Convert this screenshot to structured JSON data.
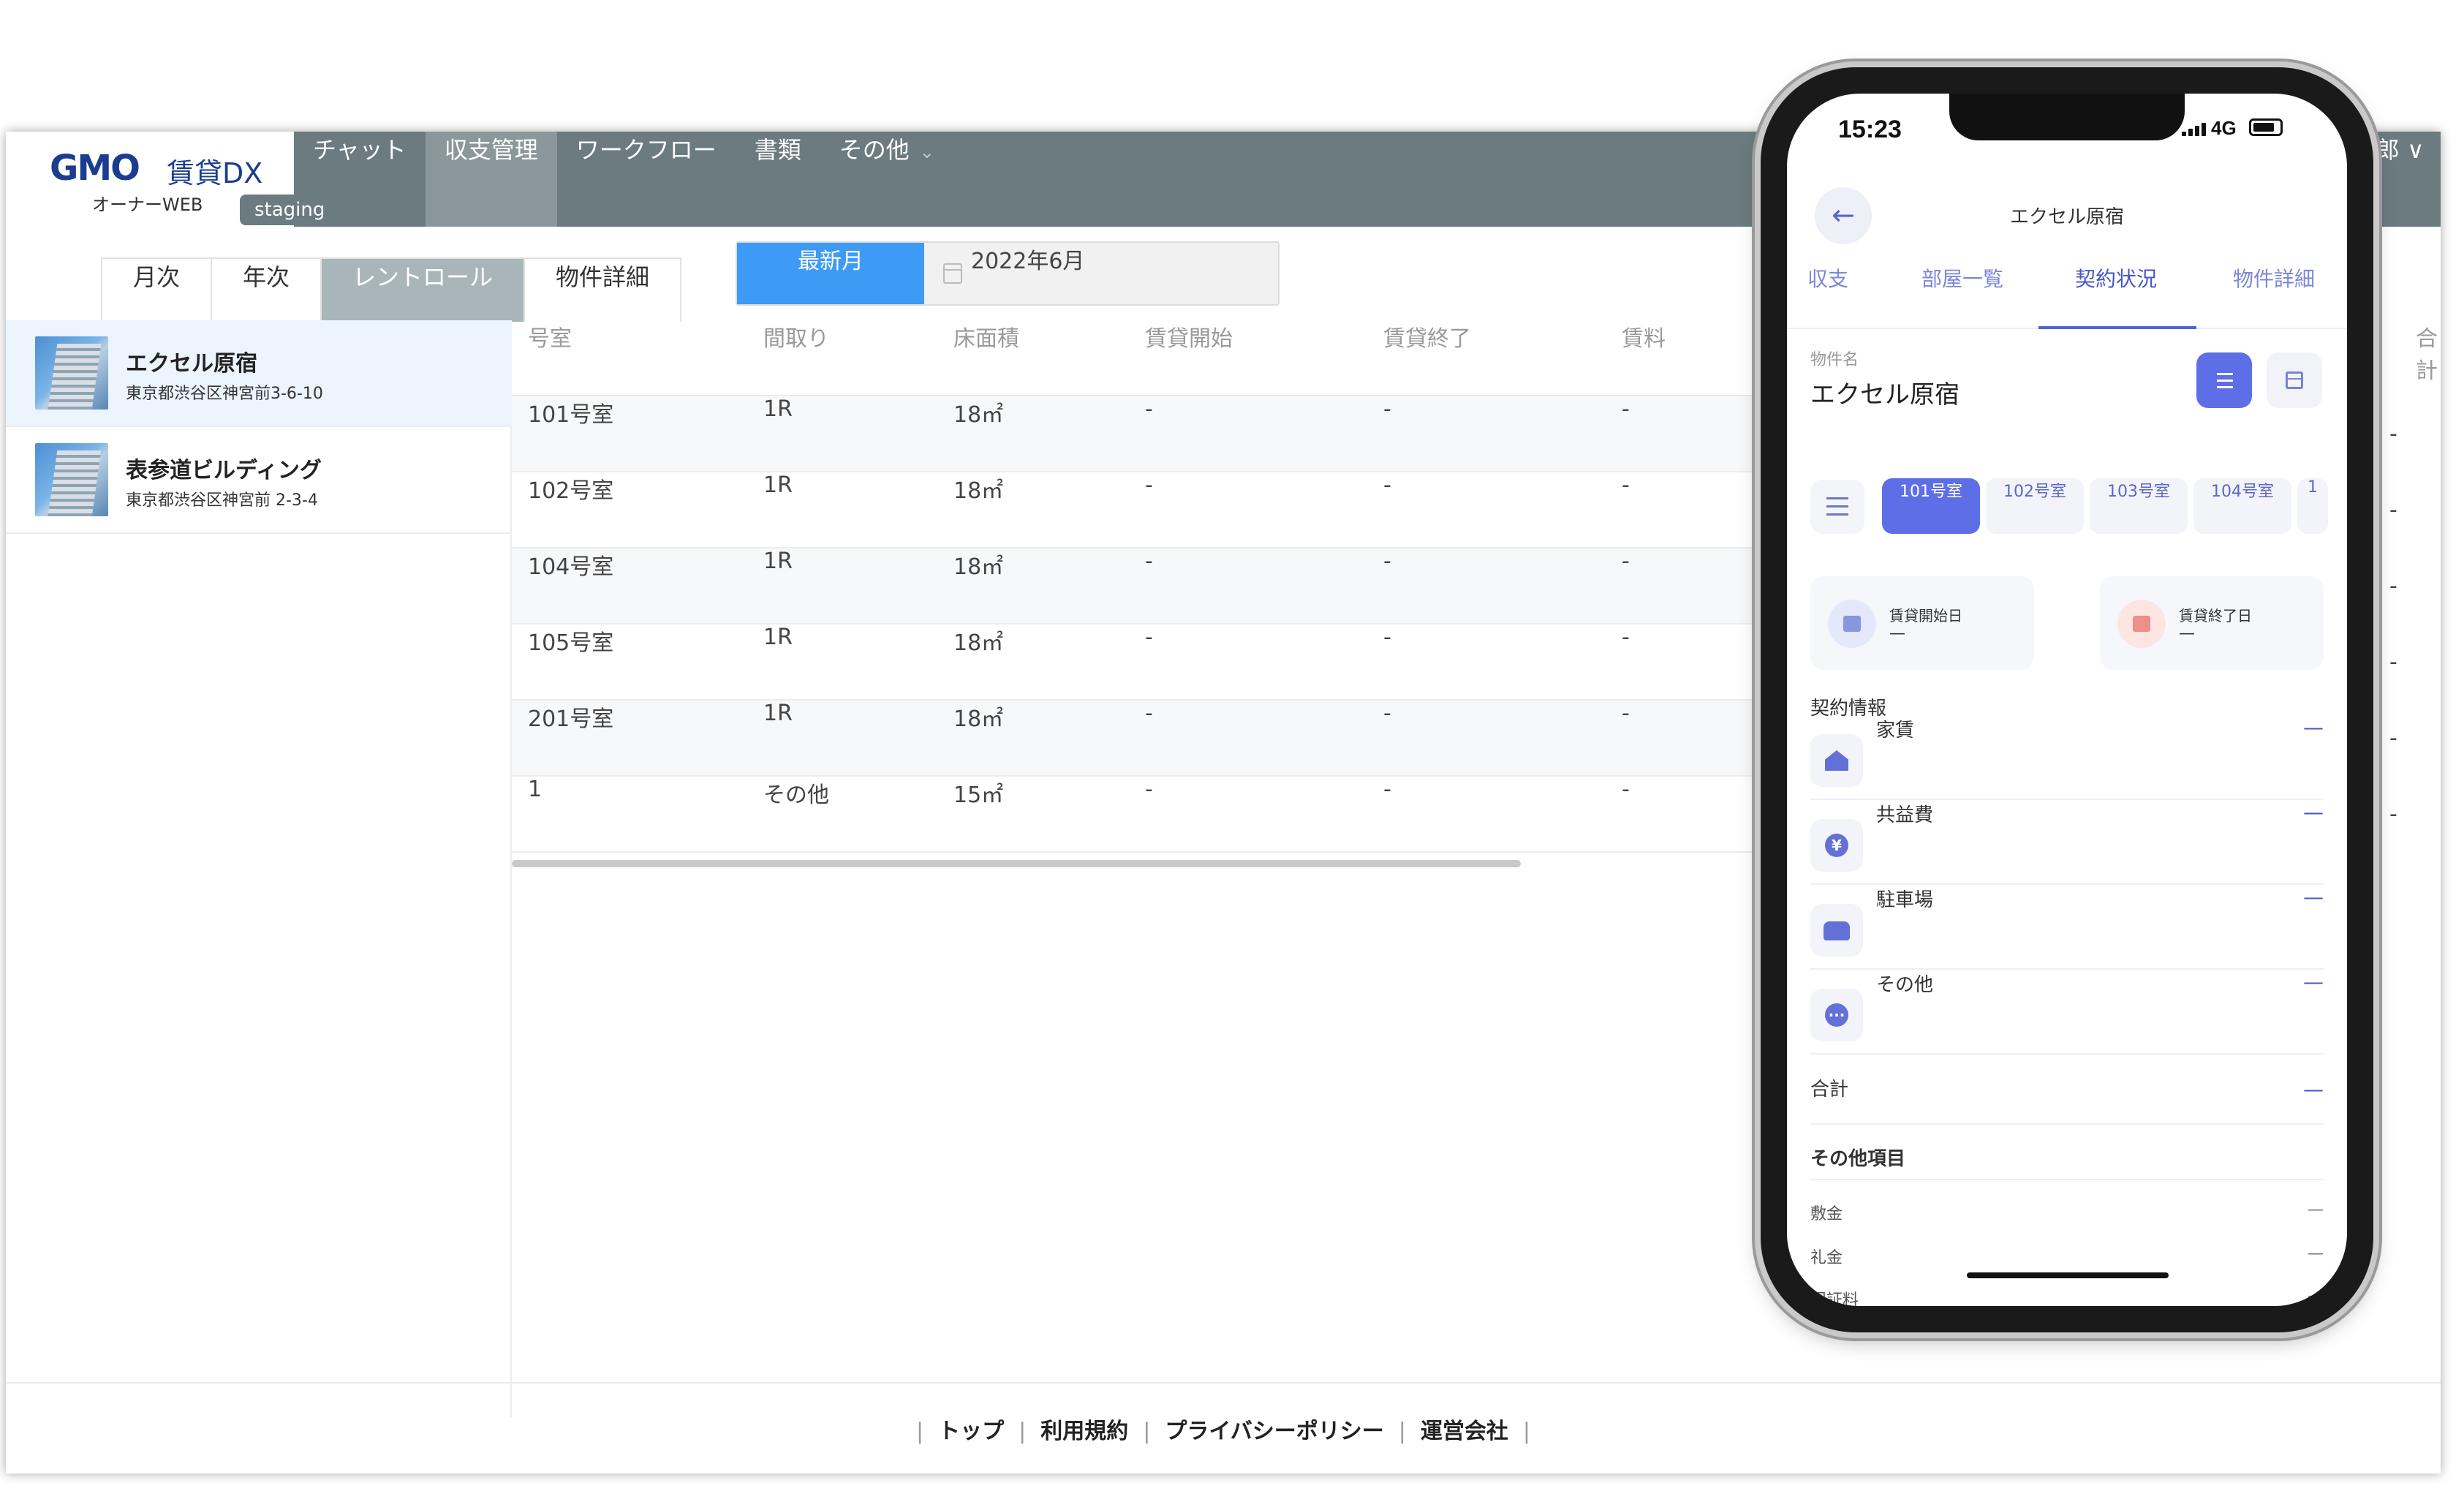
{
  "web": {
    "logo": {
      "brand": "GMO",
      "product": "賃貸DX",
      "sub": "オーナーWEB",
      "env_badge": "staging"
    },
    "nav": [
      {
        "label": "チャット"
      },
      {
        "label": "収支管理"
      },
      {
        "label": "ワークフロー"
      },
      {
        "label": "書類"
      },
      {
        "label": "その他"
      }
    ],
    "user_name_partial": "郎 ∨",
    "tabs": [
      {
        "label": "月次"
      },
      {
        "label": "年次"
      },
      {
        "label": "レントロール"
      },
      {
        "label": "物件詳細"
      }
    ],
    "month_selector": {
      "latest_label": "最新月",
      "value": "2022年6月"
    },
    "properties": [
      {
        "name": "エクセル原宿",
        "address": "東京都渋谷区神宮前3-6-10"
      },
      {
        "name": "表参道ビルディング",
        "address": "東京都渋谷区神宮前 2-3-4"
      }
    ],
    "table": {
      "headers": [
        "号室",
        "間取り",
        "床面積",
        "賃貸開始",
        "賃貸終了",
        "賃料"
      ],
      "total_header": "合計",
      "rows": [
        [
          "101号室",
          "1R",
          "18㎡",
          "-",
          "-",
          "-"
        ],
        [
          "102号室",
          "1R",
          "18㎡",
          "-",
          "-",
          "-"
        ],
        [
          "104号室",
          "1R",
          "18㎡",
          "-",
          "-",
          "-"
        ],
        [
          "105号室",
          "1R",
          "18㎡",
          "-",
          "-",
          "-"
        ],
        [
          "201号室",
          "1R",
          "18㎡",
          "-",
          "-",
          "-"
        ],
        [
          "1",
          "その他",
          "15㎡",
          "-",
          "-",
          "-"
        ]
      ],
      "edge_values": [
        "-",
        "-",
        "-",
        "-",
        "-",
        "-"
      ]
    },
    "footer": {
      "links": [
        "トップ",
        "利用規約",
        "プライバシーポリシー",
        "運営会社"
      ],
      "separator": "|"
    }
  },
  "phone": {
    "status": {
      "time": "15:23",
      "network": "4G"
    },
    "title": "エクセル原宿",
    "back_icon": "←",
    "tabs": [
      {
        "label": "収支"
      },
      {
        "label": "部屋一覧"
      },
      {
        "label": "契約状況"
      },
      {
        "label": "物件詳細"
      }
    ],
    "property_label": "物件名",
    "property_name": "エクセル原宿",
    "rooms": [
      "101号室",
      "102号室",
      "103号室",
      "104号室",
      "1"
    ],
    "dates": [
      {
        "label": "賃貸開始日",
        "value": "—"
      },
      {
        "label": "賃貸終了日",
        "value": "—"
      }
    ],
    "contract_section": "契約情報",
    "contract_items": [
      {
        "label": "家賃",
        "value": "—"
      },
      {
        "label": "共益費",
        "value": "—",
        "glyph": "¥"
      },
      {
        "label": "駐車場",
        "value": "—"
      },
      {
        "label": "その他",
        "value": "—",
        "glyph": "···"
      }
    ],
    "total": {
      "label": "合計",
      "value": "—"
    },
    "other_section": "その他項目",
    "other_items": [
      {
        "label": "敷金",
        "value": "—"
      },
      {
        "label": "礼金",
        "value": "—"
      },
      {
        "label": "保証料",
        "value": "—"
      }
    ]
  }
}
